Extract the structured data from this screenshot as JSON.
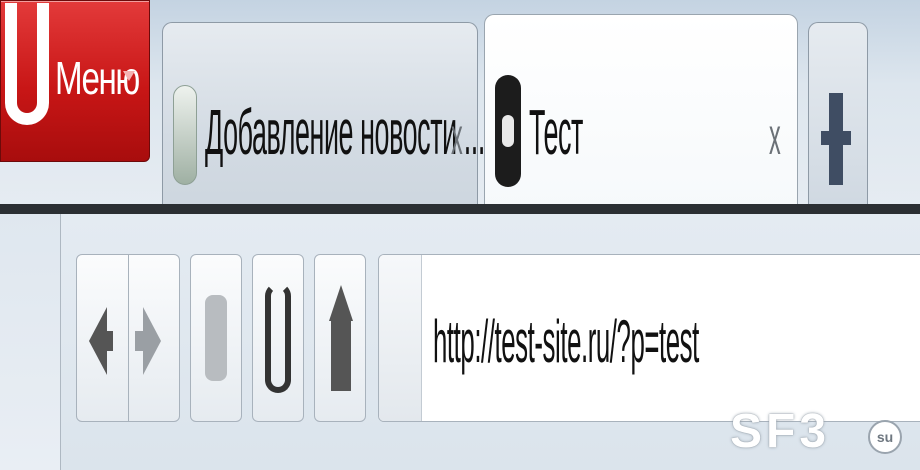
{
  "menu": {
    "label": "Меню",
    "logo_icon": "opera-logo-icon",
    "caret_icon": "caret-down-icon"
  },
  "tabs": [
    {
      "title": "Добавление новости ...",
      "close": "x",
      "icon": "globe-icon",
      "active": false
    },
    {
      "title": "Тест",
      "close": "x",
      "icon": "disc-icon",
      "active": true
    }
  ],
  "new_tab_icon": "plus-icon",
  "toolbar": {
    "back_icon": "arrow-left-icon",
    "forward_icon": "arrow-right-icon",
    "key_icon": "key-icon",
    "reload_icon": "reload-icon",
    "home_icon": "home-icon"
  },
  "address": {
    "url": "http://test-site.ru/?p=test"
  },
  "watermark": {
    "text": "SF3",
    "badge": "su"
  },
  "colors": {
    "menu_red": "#c81616",
    "divider": "#2b2f33",
    "toolbar_bg": "#dbe4ec"
  }
}
